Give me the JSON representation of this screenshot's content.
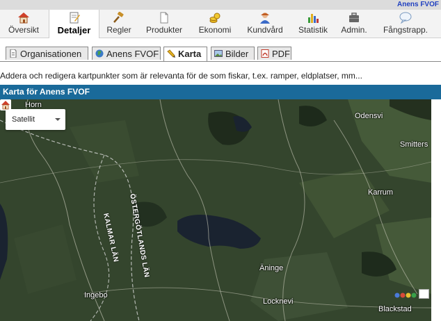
{
  "org_name": "Anens FVOF",
  "nav": [
    {
      "label": "Översikt",
      "icon": "home-icon"
    },
    {
      "label": "Detaljer",
      "icon": "edit-document-icon"
    },
    {
      "label": "Regler",
      "icon": "gavel-icon"
    },
    {
      "label": "Produkter",
      "icon": "document-icon"
    },
    {
      "label": "Ekonomi",
      "icon": "coins-icon"
    },
    {
      "label": "Kundvård",
      "icon": "user-icon"
    },
    {
      "label": "Statistik",
      "icon": "bar-chart-icon"
    },
    {
      "label": "Admin.",
      "icon": "briefcase-icon"
    },
    {
      "label": "Fångstrapp.",
      "icon": "speech-bubble-icon"
    }
  ],
  "subtabs": [
    {
      "label": "Organisationen",
      "icon": "document-icon"
    },
    {
      "label": "Anens FVOF",
      "icon": "globe-icon"
    },
    {
      "label": "Karta",
      "icon": "pencil-icon"
    },
    {
      "label": "Bilder",
      "icon": "picture-icon"
    },
    {
      "label": "PDF",
      "icon": "pdf-icon"
    }
  ],
  "description": "Addera och redigera kartpunkter som är relevanta för de som fiskar, t.ex. ramper, eldplatser, mm...",
  "map_header": "Karta för Anens FVOF",
  "map": {
    "map_type": "Satellit",
    "labels": {
      "horn": "Horn",
      "odensvi": "Odensvi",
      "smitters": "Smitters",
      "karrum": "Karrum",
      "aninge": "Äninge",
      "ingebo": "Ingebo",
      "locknevi": "Locknevi",
      "blackstad": "Blackstad",
      "kalmar_lan": "KALMAR LÄN",
      "ostergotlands_lan": "ÖSTERGÖTLANDS LÄN"
    }
  }
}
